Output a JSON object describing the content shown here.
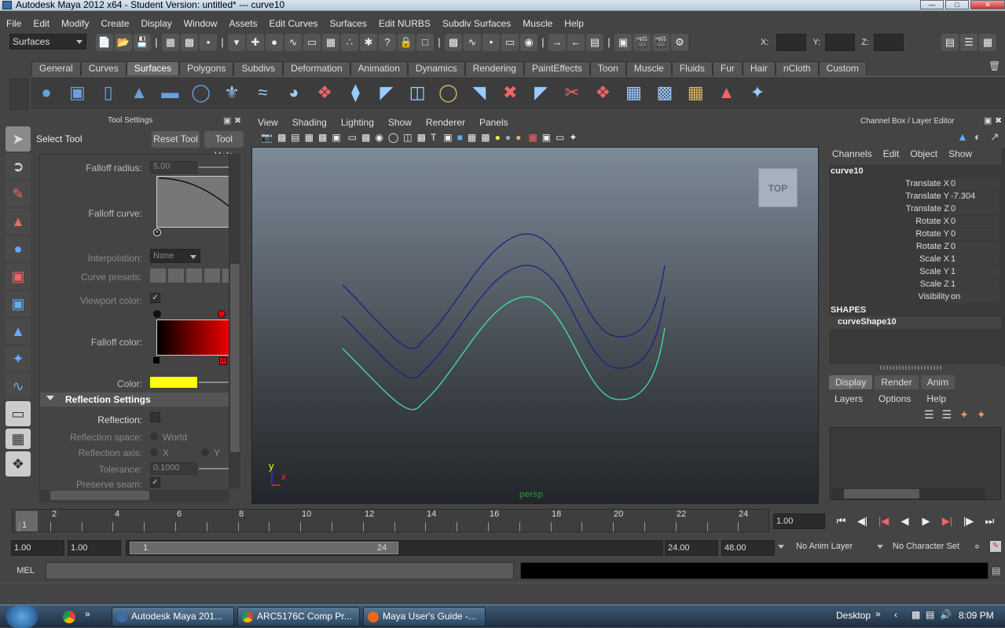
{
  "window": {
    "title": "Autodesk Maya 2012 x64 - Student Version: untitled*   ---   curve10"
  },
  "menu": [
    "File",
    "Edit",
    "Modify",
    "Create",
    "Display",
    "Window",
    "Assets",
    "Edit Curves",
    "Surfaces",
    "Edit NURBS",
    "Subdiv Surfaces",
    "Muscle",
    "Help"
  ],
  "status": {
    "menuset": "Surfaces",
    "x_label": "X:",
    "y_label": "Y:",
    "z_label": "Z:"
  },
  "shelf_tabs": [
    "General",
    "Curves",
    "Surfaces",
    "Polygons",
    "Subdivs",
    "Deformation",
    "Animation",
    "Dynamics",
    "Rendering",
    "PaintEffects",
    "Toon",
    "Muscle",
    "Fluids",
    "Fur",
    "Hair",
    "nCloth",
    "Custom"
  ],
  "shelf_active": "Surfaces",
  "tool_settings": {
    "panel_title": "Tool Settings",
    "tool_name": "Select Tool",
    "reset_label": "Reset Tool",
    "help_label": "Tool Help",
    "falloff_radius_label": "Falloff radius:",
    "falloff_radius_value": "5.00",
    "falloff_curve_label": "Falloff curve:",
    "interpolation_label": "Interpolation:",
    "interpolation_value": "None",
    "curve_presets_label": "Curve presets:",
    "viewport_color_label": "Viewport color:",
    "falloff_color_label": "Falloff color:",
    "color_label": "Color:",
    "color_value": "#ffff00",
    "reflection_header": "Reflection Settings",
    "reflection_label": "Reflection:",
    "reflection_space_label": "Reflection space:",
    "reflection_space_value": "World",
    "reflection_axis_label": "Reflection axis:",
    "axis_x": "X",
    "axis_y": "Y",
    "tolerance_label": "Tolerance:",
    "tolerance_value": "0.1000",
    "preserve_seam_label": "Preserve seam:"
  },
  "viewport": {
    "menus": [
      "View",
      "Shading",
      "Lighting",
      "Show",
      "Renderer",
      "Panels"
    ],
    "camera": "persp",
    "viewcube": "TOP",
    "axis_y": "y",
    "axis_x": "x",
    "curve_color_dark": "#1a237e",
    "curve_color_selected": "#40e0a0"
  },
  "channel_box": {
    "title": "Channel Box / Layer Editor",
    "menus": [
      "Channels",
      "Edit",
      "Object",
      "Show"
    ],
    "object": "curve10",
    "channels": [
      {
        "name": "Translate X",
        "value": "0"
      },
      {
        "name": "Translate Y",
        "value": "-7.304"
      },
      {
        "name": "Translate Z",
        "value": "0"
      },
      {
        "name": "Rotate X",
        "value": "0"
      },
      {
        "name": "Rotate Y",
        "value": "0"
      },
      {
        "name": "Rotate Z",
        "value": "0"
      },
      {
        "name": "Scale X",
        "value": "1"
      },
      {
        "name": "Scale Y",
        "value": "1"
      },
      {
        "name": "Scale Z",
        "value": "1"
      },
      {
        "name": "Visibility",
        "value": "on"
      }
    ],
    "shapes_label": "SHAPES",
    "shape": "curveShape10"
  },
  "layer_editor": {
    "tabs": [
      "Display",
      "Render",
      "Anim"
    ],
    "menus": [
      "Layers",
      "Options",
      "Help"
    ]
  },
  "time": {
    "ticks": [
      "1",
      "2",
      "4",
      "6",
      "8",
      "10",
      "12",
      "14",
      "16",
      "18",
      "20",
      "22",
      "24"
    ],
    "current": "1.00",
    "range_start": "1.00",
    "play_start": "1.00",
    "slider_start": "1",
    "slider_end": "24",
    "play_end": "24.00",
    "range_end": "48.00",
    "anim_layer": "No Anim Layer",
    "char_set": "No Character Set"
  },
  "mel": {
    "label": "MEL"
  },
  "taskbar": {
    "items": [
      "Autodesk Maya 201...",
      "ARC5176C Comp Pr...",
      "Maya User's Guide -..."
    ],
    "desktop": "Desktop",
    "clock": "8:09 PM"
  }
}
